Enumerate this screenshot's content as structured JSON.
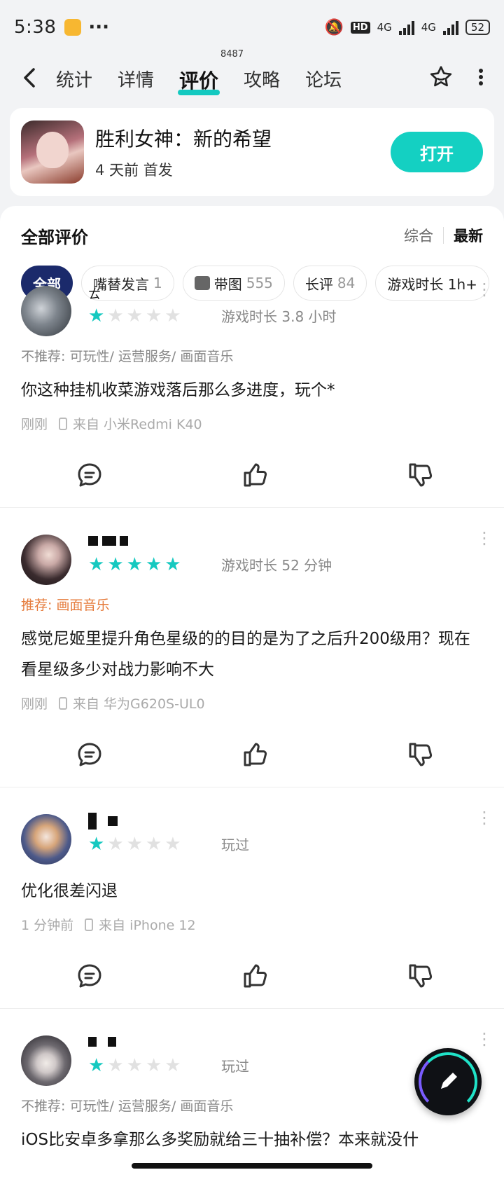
{
  "status_bar": {
    "time": "5:38",
    "more": "···",
    "network1": "4G",
    "network2": "4G",
    "hd": "HD",
    "battery": "52"
  },
  "nav": {
    "tabs": [
      {
        "label": "统计"
      },
      {
        "label": "详情"
      },
      {
        "label": "评价",
        "count": "8487"
      },
      {
        "label": "攻略"
      },
      {
        "label": "论坛"
      }
    ]
  },
  "game": {
    "title": "胜利女神：新的希望",
    "subtitle": "4 天前 首发",
    "open_label": "打开"
  },
  "reviews_header": {
    "title": "全部评价",
    "sort_options": [
      "综合",
      "最新"
    ],
    "active_sort": "最新"
  },
  "filters": [
    {
      "label": "全部",
      "count": ""
    },
    {
      "label": "嘴替发言",
      "count": "1"
    },
    {
      "label": "带图",
      "count": "555"
    },
    {
      "label": "长评",
      "count": "84"
    },
    {
      "label": "游戏时长 1h+",
      "count": ""
    }
  ],
  "reviews": [
    {
      "username": "ㄊ",
      "rating": 1,
      "playtime": "游戏时长 3.8 小时",
      "tags": "不推荐: 可玩性/ 运营服务/ 画面音乐",
      "content": "你这种挂机收菜游戏落后那么多进度，玩个*",
      "time": "刚刚",
      "device": "来自  小米Redmi K40"
    },
    {
      "username": "",
      "rating": 5,
      "playtime": "游戏时长 52 分钟",
      "tags": "推荐: 画面音乐",
      "content": "感觉尼姬里提升角色星级的的目的是为了之后升200级用？现在看星级多少对战力影响不大",
      "time": "刚刚",
      "device": "来自  华为G620S-UL0"
    },
    {
      "username": "",
      "rating": 1,
      "playtime": "玩过",
      "tags": "",
      "content": "优化很差闪退",
      "time": "1 分钟前",
      "device": "来自  iPhone 12"
    },
    {
      "username": "",
      "rating": 1,
      "playtime": "玩过",
      "tags": "不推荐: 可玩性/ 运营服务/ 画面音乐",
      "content": "iOS比安卓多拿那么多奖励就给三十抽补偿？本来就没什",
      "time": "",
      "device": ""
    }
  ],
  "colors": {
    "accent": "#14c9c0",
    "chip_active": "#1b2a6b",
    "recommend": "#e57a3a"
  },
  "icons": {
    "back": "chevron-left-icon",
    "favorite": "star-icon",
    "menu": "more-vertical-icon",
    "comment": "comment-icon",
    "like": "thumb-up-icon",
    "dislike": "thumb-down-icon",
    "write": "pen-icon"
  }
}
